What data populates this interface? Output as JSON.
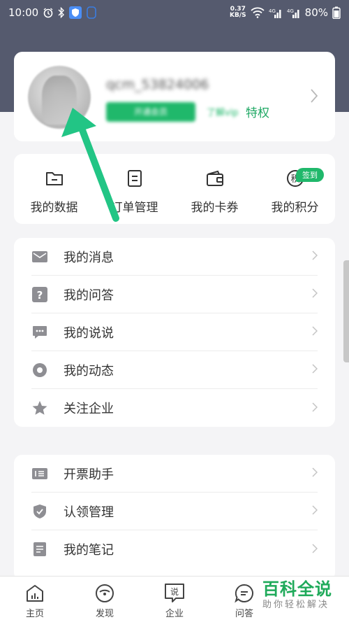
{
  "status_bar": {
    "time": "10:00",
    "net_speed_value": "0.37",
    "net_speed_unit": "KB/S",
    "battery": "80%"
  },
  "profile": {
    "username": "qcm_53824006",
    "vip_pill": "开通会员",
    "vip_sub": "了解vip",
    "privilege": "特权"
  },
  "quick_actions": [
    {
      "label": "我的数据",
      "icon": "folder-icon"
    },
    {
      "label": "订单管理",
      "icon": "document-icon"
    },
    {
      "label": "我的卡券",
      "icon": "wallet-icon"
    },
    {
      "label": "我的积分",
      "icon": "points-icon",
      "badge": "签到",
      "icon_text": "积"
    }
  ],
  "menu_group_1": [
    {
      "label": "我的消息",
      "icon": "mail-icon"
    },
    {
      "label": "我的问答",
      "icon": "question-icon"
    },
    {
      "label": "我的说说",
      "icon": "chat-bubble-icon"
    },
    {
      "label": "我的动态",
      "icon": "activity-ring-icon"
    },
    {
      "label": "关注企业",
      "icon": "star-icon"
    }
  ],
  "menu_group_2": [
    {
      "label": "开票助手",
      "icon": "invoice-icon"
    },
    {
      "label": "认领管理",
      "icon": "shield-icon"
    },
    {
      "label": "我的笔记",
      "icon": "note-icon"
    }
  ],
  "bottom_nav": [
    {
      "label": "主页",
      "icon": "home-chart-icon"
    },
    {
      "label": "发现",
      "icon": "discover-icon"
    },
    {
      "label": "企业",
      "icon": "company-icon",
      "icon_text": "说"
    },
    {
      "label": "问答",
      "icon": "qa-icon"
    }
  ],
  "watermark": {
    "title": "百科全说",
    "subtitle": "助你轻松解决"
  },
  "colors": {
    "header": "#555a6e",
    "accent": "#20b86b",
    "annotation_arrow": "#22c585"
  }
}
